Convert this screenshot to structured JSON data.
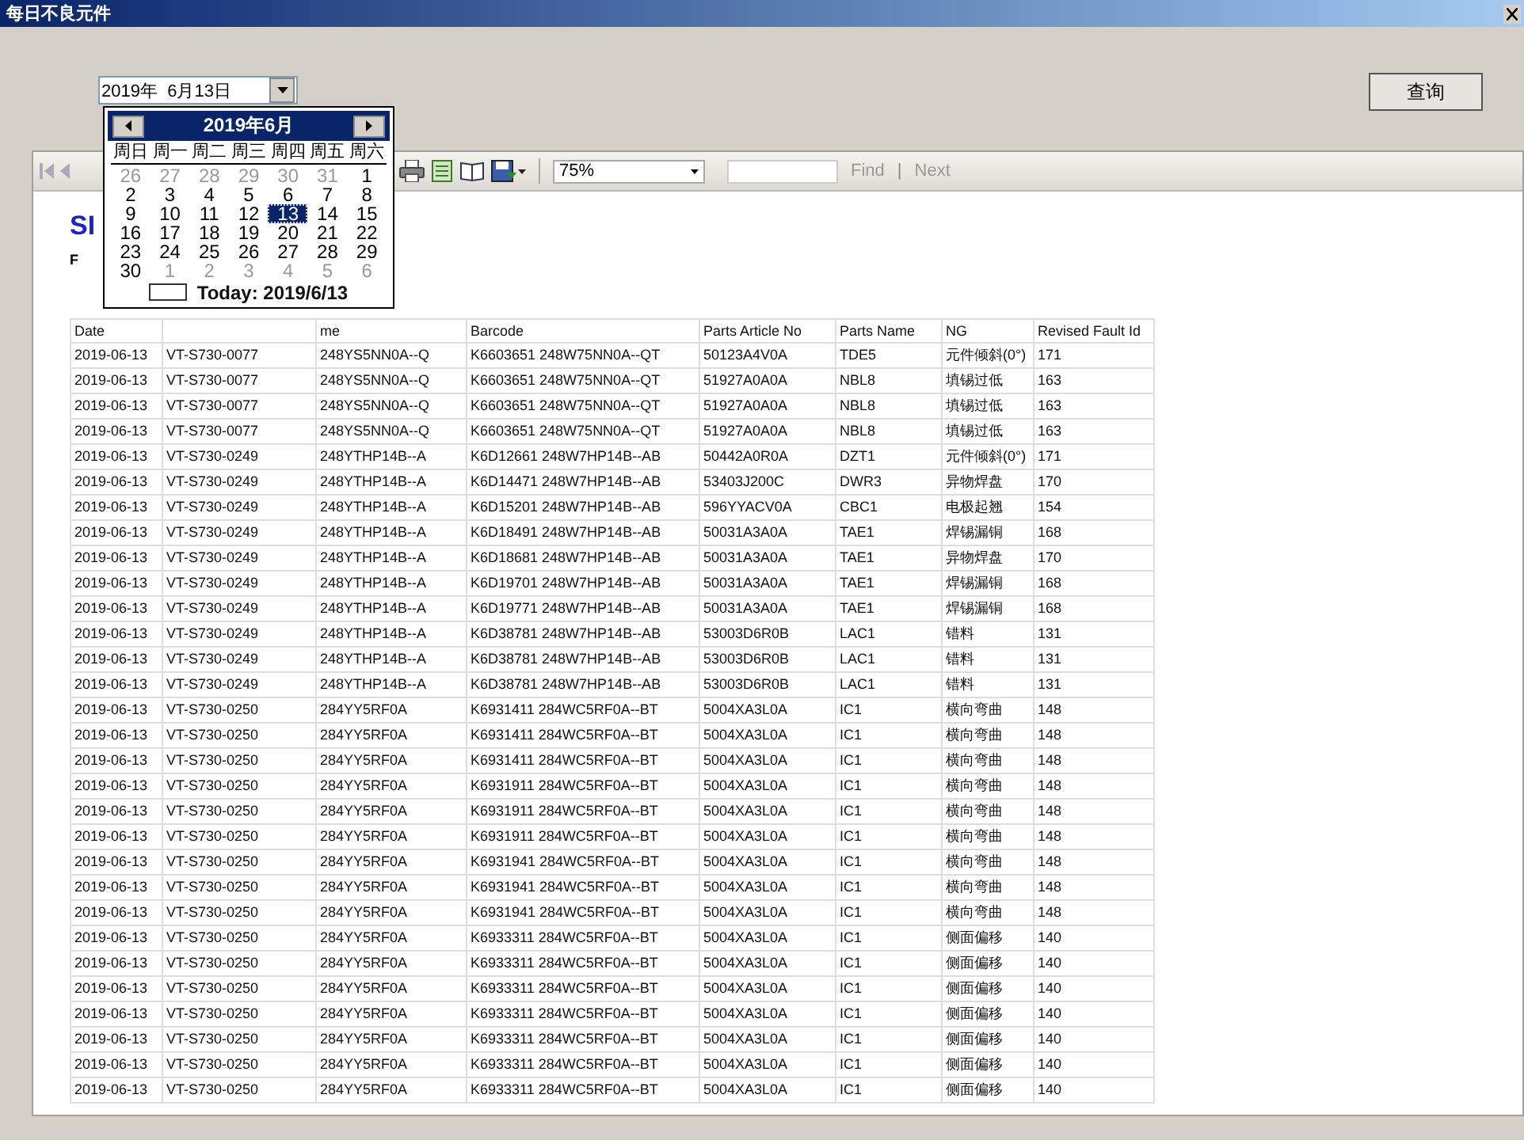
{
  "window": {
    "title": "每日不良元件"
  },
  "date_field": {
    "value": "2019年  6月13日"
  },
  "query_button": "查询",
  "calendar": {
    "month_title": "2019年6月",
    "weekdays": [
      "周日",
      "周一",
      "周二",
      "周三",
      "周四",
      "周五",
      "周六"
    ],
    "days": [
      {
        "label": "26",
        "other_month": true,
        "selected": false
      },
      {
        "label": "27",
        "other_month": true,
        "selected": false
      },
      {
        "label": "28",
        "other_month": true,
        "selected": false
      },
      {
        "label": "29",
        "other_month": true,
        "selected": false
      },
      {
        "label": "30",
        "other_month": true,
        "selected": false
      },
      {
        "label": "31",
        "other_month": true,
        "selected": false
      },
      {
        "label": "1",
        "other_month": false,
        "selected": false
      },
      {
        "label": "2",
        "other_month": false,
        "selected": false
      },
      {
        "label": "3",
        "other_month": false,
        "selected": false
      },
      {
        "label": "4",
        "other_month": false,
        "selected": false
      },
      {
        "label": "5",
        "other_month": false,
        "selected": false
      },
      {
        "label": "6",
        "other_month": false,
        "selected": false
      },
      {
        "label": "7",
        "other_month": false,
        "selected": false
      },
      {
        "label": "8",
        "other_month": false,
        "selected": false
      },
      {
        "label": "9",
        "other_month": false,
        "selected": false
      },
      {
        "label": "10",
        "other_month": false,
        "selected": false
      },
      {
        "label": "11",
        "other_month": false,
        "selected": false
      },
      {
        "label": "12",
        "other_month": false,
        "selected": false
      },
      {
        "label": "13",
        "other_month": false,
        "selected": true
      },
      {
        "label": "14",
        "other_month": false,
        "selected": false
      },
      {
        "label": "15",
        "other_month": false,
        "selected": false
      },
      {
        "label": "16",
        "other_month": false,
        "selected": false
      },
      {
        "label": "17",
        "other_month": false,
        "selected": false
      },
      {
        "label": "18",
        "other_month": false,
        "selected": false
      },
      {
        "label": "19",
        "other_month": false,
        "selected": false
      },
      {
        "label": "20",
        "other_month": false,
        "selected": false
      },
      {
        "label": "21",
        "other_month": false,
        "selected": false
      },
      {
        "label": "22",
        "other_month": false,
        "selected": false
      },
      {
        "label": "23",
        "other_month": false,
        "selected": false
      },
      {
        "label": "24",
        "other_month": false,
        "selected": false
      },
      {
        "label": "25",
        "other_month": false,
        "selected": false
      },
      {
        "label": "26",
        "other_month": false,
        "selected": false
      },
      {
        "label": "27",
        "other_month": false,
        "selected": false
      },
      {
        "label": "28",
        "other_month": false,
        "selected": false
      },
      {
        "label": "29",
        "other_month": false,
        "selected": false
      },
      {
        "label": "30",
        "other_month": false,
        "selected": false
      },
      {
        "label": "1",
        "other_month": true,
        "selected": false
      },
      {
        "label": "2",
        "other_month": true,
        "selected": false
      },
      {
        "label": "3",
        "other_month": true,
        "selected": false
      },
      {
        "label": "4",
        "other_month": true,
        "selected": false
      },
      {
        "label": "5",
        "other_month": true,
        "selected": false
      },
      {
        "label": "6",
        "other_month": true,
        "selected": false
      }
    ],
    "today": "Today: 2019/6/13"
  },
  "toolbar": {
    "zoom": "75%",
    "find": "Find",
    "separator": "|",
    "next": "Next"
  },
  "report": {
    "title": "SI",
    "subtitle": "F",
    "columns": [
      "Date",
      null,
      "me",
      "Barcode",
      "Parts Article No",
      "Parts Name",
      "NG",
      "Revised Fault Id"
    ],
    "rows": [
      [
        "2019-06-13",
        "VT-S730-0077",
        "248YS5NN0A--Q",
        "K6603651 248W75NN0A--QT",
        "50123A4V0A",
        "TDE5",
        "元件倾斜(0°)",
        "171"
      ],
      [
        "2019-06-13",
        "VT-S730-0077",
        "248YS5NN0A--Q",
        "K6603651 248W75NN0A--QT",
        "51927A0A0A",
        "NBL8",
        "填锡过低",
        "163"
      ],
      [
        "2019-06-13",
        "VT-S730-0077",
        "248YS5NN0A--Q",
        "K6603651 248W75NN0A--QT",
        "51927A0A0A",
        "NBL8",
        "填锡过低",
        "163"
      ],
      [
        "2019-06-13",
        "VT-S730-0077",
        "248YS5NN0A--Q",
        "K6603651 248W75NN0A--QT",
        "51927A0A0A",
        "NBL8",
        "填锡过低",
        "163"
      ],
      [
        "2019-06-13",
        "VT-S730-0249",
        "248YTHP14B--A",
        "K6D12661 248W7HP14B--AB",
        "50442A0R0A",
        "DZT1",
        "元件倾斜(0°)",
        "171"
      ],
      [
        "2019-06-13",
        "VT-S730-0249",
        "248YTHP14B--A",
        "K6D14471 248W7HP14B--AB",
        "53403J200C",
        "DWR3",
        "异物焊盘",
        "170"
      ],
      [
        "2019-06-13",
        "VT-S730-0249",
        "248YTHP14B--A",
        "K6D15201 248W7HP14B--AB",
        "596YYACV0A",
        "CBC1",
        "电极起翘",
        "154"
      ],
      [
        "2019-06-13",
        "VT-S730-0249",
        "248YTHP14B--A",
        "K6D18491 248W7HP14B--AB",
        "50031A3A0A",
        "TAE1",
        "焊锡漏铜",
        "168"
      ],
      [
        "2019-06-13",
        "VT-S730-0249",
        "248YTHP14B--A",
        "K6D18681 248W7HP14B--AB",
        "50031A3A0A",
        "TAE1",
        "异物焊盘",
        "170"
      ],
      [
        "2019-06-13",
        "VT-S730-0249",
        "248YTHP14B--A",
        "K6D19701 248W7HP14B--AB",
        "50031A3A0A",
        "TAE1",
        "焊锡漏铜",
        "168"
      ],
      [
        "2019-06-13",
        "VT-S730-0249",
        "248YTHP14B--A",
        "K6D19771 248W7HP14B--AB",
        "50031A3A0A",
        "TAE1",
        "焊锡漏铜",
        "168"
      ],
      [
        "2019-06-13",
        "VT-S730-0249",
        "248YTHP14B--A",
        "K6D38781 248W7HP14B--AB",
        "53003D6R0B",
        "LAC1",
        "错料",
        "131"
      ],
      [
        "2019-06-13",
        "VT-S730-0249",
        "248YTHP14B--A",
        "K6D38781 248W7HP14B--AB",
        "53003D6R0B",
        "LAC1",
        "错料",
        "131"
      ],
      [
        "2019-06-13",
        "VT-S730-0249",
        "248YTHP14B--A",
        "K6D38781 248W7HP14B--AB",
        "53003D6R0B",
        "LAC1",
        "错料",
        "131"
      ],
      [
        "2019-06-13",
        "VT-S730-0250",
        "284YY5RF0A",
        "K6931411 284WC5RF0A--BT",
        "5004XA3L0A",
        "IC1",
        "横向弯曲",
        "148"
      ],
      [
        "2019-06-13",
        "VT-S730-0250",
        "284YY5RF0A",
        "K6931411 284WC5RF0A--BT",
        "5004XA3L0A",
        "IC1",
        "横向弯曲",
        "148"
      ],
      [
        "2019-06-13",
        "VT-S730-0250",
        "284YY5RF0A",
        "K6931411 284WC5RF0A--BT",
        "5004XA3L0A",
        "IC1",
        "横向弯曲",
        "148"
      ],
      [
        "2019-06-13",
        "VT-S730-0250",
        "284YY5RF0A",
        "K6931911 284WC5RF0A--BT",
        "5004XA3L0A",
        "IC1",
        "横向弯曲",
        "148"
      ],
      [
        "2019-06-13",
        "VT-S730-0250",
        "284YY5RF0A",
        "K6931911 284WC5RF0A--BT",
        "5004XA3L0A",
        "IC1",
        "横向弯曲",
        "148"
      ],
      [
        "2019-06-13",
        "VT-S730-0250",
        "284YY5RF0A",
        "K6931911 284WC5RF0A--BT",
        "5004XA3L0A",
        "IC1",
        "横向弯曲",
        "148"
      ],
      [
        "2019-06-13",
        "VT-S730-0250",
        "284YY5RF0A",
        "K6931941 284WC5RF0A--BT",
        "5004XA3L0A",
        "IC1",
        "横向弯曲",
        "148"
      ],
      [
        "2019-06-13",
        "VT-S730-0250",
        "284YY5RF0A",
        "K6931941 284WC5RF0A--BT",
        "5004XA3L0A",
        "IC1",
        "横向弯曲",
        "148"
      ],
      [
        "2019-06-13",
        "VT-S730-0250",
        "284YY5RF0A",
        "K6931941 284WC5RF0A--BT",
        "5004XA3L0A",
        "IC1",
        "横向弯曲",
        "148"
      ],
      [
        "2019-06-13",
        "VT-S730-0250",
        "284YY5RF0A",
        "K6933311 284WC5RF0A--BT",
        "5004XA3L0A",
        "IC1",
        "侧面偏移",
        "140"
      ],
      [
        "2019-06-13",
        "VT-S730-0250",
        "284YY5RF0A",
        "K6933311 284WC5RF0A--BT",
        "5004XA3L0A",
        "IC1",
        "侧面偏移",
        "140"
      ],
      [
        "2019-06-13",
        "VT-S730-0250",
        "284YY5RF0A",
        "K6933311 284WC5RF0A--BT",
        "5004XA3L0A",
        "IC1",
        "侧面偏移",
        "140"
      ],
      [
        "2019-06-13",
        "VT-S730-0250",
        "284YY5RF0A",
        "K6933311 284WC5RF0A--BT",
        "5004XA3L0A",
        "IC1",
        "侧面偏移",
        "140"
      ],
      [
        "2019-06-13",
        "VT-S730-0250",
        "284YY5RF0A",
        "K6933311 284WC5RF0A--BT",
        "5004XA3L0A",
        "IC1",
        "侧面偏移",
        "140"
      ],
      [
        "2019-06-13",
        "VT-S730-0250",
        "284YY5RF0A",
        "K6933311 284WC5RF0A--BT",
        "5004XA3L0A",
        "IC1",
        "侧面偏移",
        "140"
      ],
      [
        "2019-06-13",
        "VT-S730-0250",
        "284YY5RF0A",
        "K6933311 284WC5RF0A--BT",
        "5004XA3L0A",
        "IC1",
        "侧面偏移",
        "140"
      ]
    ]
  }
}
